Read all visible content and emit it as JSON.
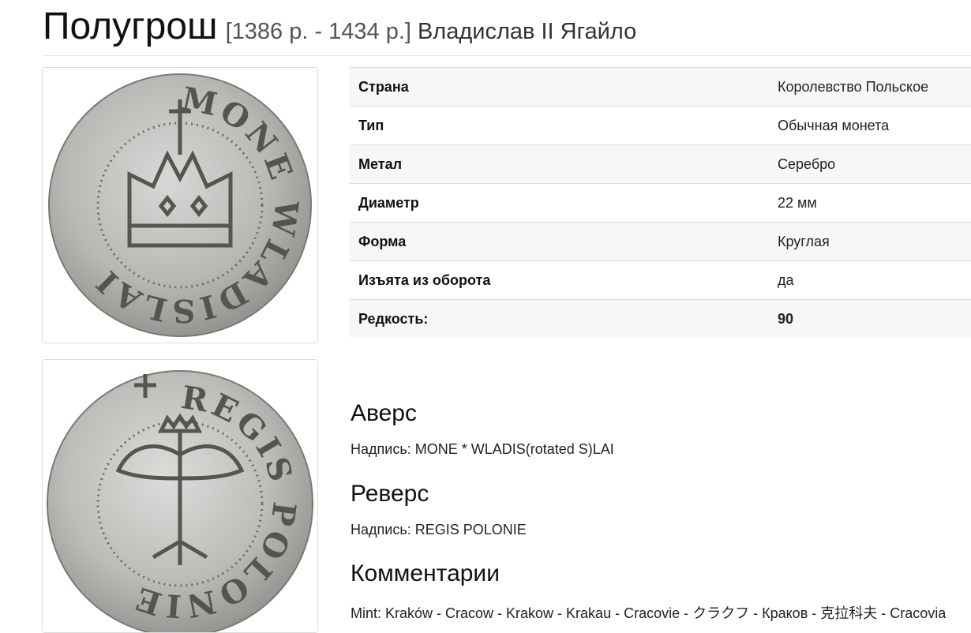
{
  "title": {
    "name": "Полугрош",
    "years": "[1386 р. - 1434 р.]",
    "ruler": "Владислав II Ягайло"
  },
  "specs": [
    {
      "key": "Страна",
      "value": "Королевство Польское"
    },
    {
      "key": "Тип",
      "value": "Обычная монета"
    },
    {
      "key": "Метал",
      "value": "Серебро"
    },
    {
      "key": "Диаметр",
      "value": "22 мм"
    },
    {
      "key": "Форма",
      "value": "Круглая"
    },
    {
      "key": "Изъята из оборота",
      "value": "да"
    },
    {
      "key": "Редкость:",
      "value": "90"
    }
  ],
  "obverse": {
    "heading": "Аверс",
    "inscription": "Надпись: MONE * WLADIS(rotated S)LAI"
  },
  "reverse": {
    "heading": "Реверс",
    "inscription": "Надпись: REGIS POLONIE"
  },
  "comments": {
    "heading": "Комментарии",
    "text": "Mint: Kraków - Cracow - Krakow - Krakau - Cracovie - クラクフ - Краков - 克拉科夫 - Cracovia"
  },
  "coin_obverse_legend": "MONE WLADISLAI",
  "coin_reverse_legend": "REGIS POLONIE"
}
